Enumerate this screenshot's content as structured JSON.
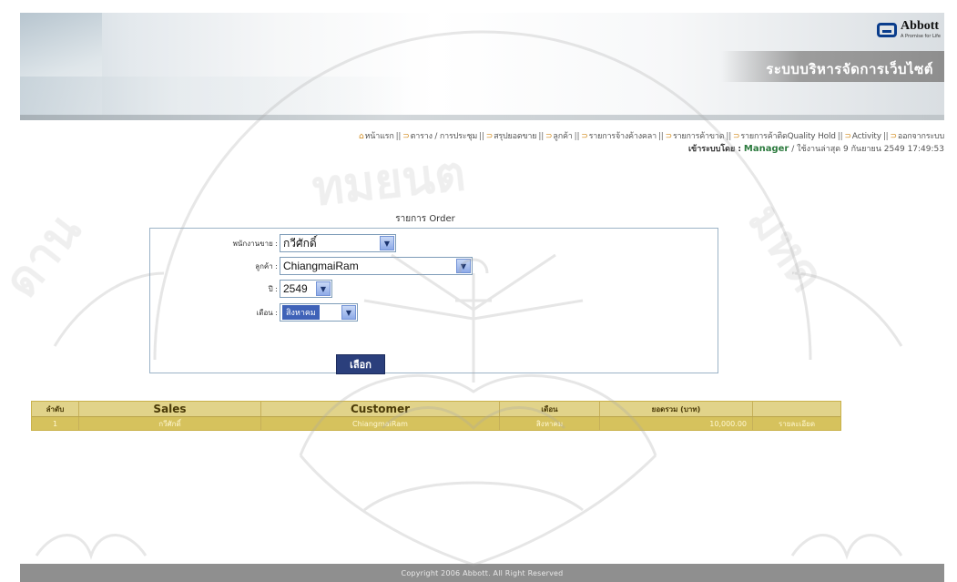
{
  "header": {
    "site_title": "ระบบบริหารจัดการเว็บไซต์",
    "logo_name": "Abbott",
    "logo_tagline": "A Promise for Life"
  },
  "nav": {
    "items": [
      {
        "label": "หน้าแรก"
      },
      {
        "label": "ตาราง / การประชุม"
      },
      {
        "label": "สรุปยอดขาย"
      },
      {
        "label": "ลูกค้า"
      },
      {
        "label": "รายการจ้างค้างคลา"
      },
      {
        "label": "รายการค้าขาด"
      },
      {
        "label": "รายการค้าติดQuality Hold"
      },
      {
        "label": "Activity"
      },
      {
        "label": "ออกจากระบบ"
      }
    ]
  },
  "login": {
    "label": "เข้าระบบโดย :",
    "role": "Manager",
    "last_login": "/ ใช้งานล่าสุด 9 กันยายน 2549 17:49:53"
  },
  "page": {
    "heading": "รายการ Order"
  },
  "form": {
    "sales_label": "พนักงานขาย :",
    "sales_value": "กวีศักดิ์",
    "customer_label": "ลูกค้า :",
    "customer_value": "ChiangmaiRam",
    "year_label": "ปี :",
    "year_value": "2549",
    "month_label": "เดือน :",
    "month_value": "สิงหาคม",
    "submit_label": "เลือก"
  },
  "table": {
    "headers": [
      "ลำดับ",
      "Sales",
      "Customer",
      "เดือน",
      "ยอดรวม (บาท)",
      ""
    ],
    "rows": [
      [
        "1",
        "กวีศักดิ์",
        "ChiangmaiRam",
        "สิงหาคม",
        "10,000.00",
        "รายละเอียด"
      ]
    ]
  },
  "footer": {
    "text": "Copyright 2006 Abbott. All Right Reserved"
  }
}
